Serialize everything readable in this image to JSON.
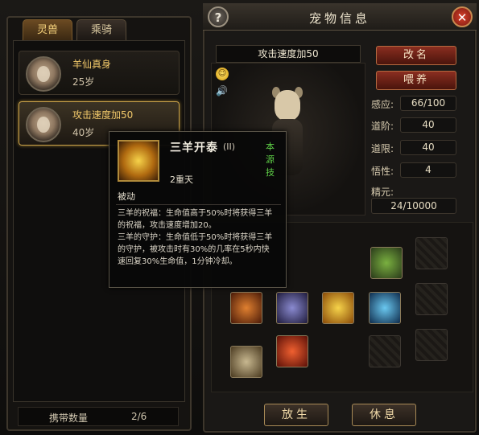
{
  "tabs": [
    "灵兽",
    "乘骑"
  ],
  "pets": [
    {
      "name": "羊仙真身",
      "age": "25岁",
      "selected": false
    },
    {
      "name": "攻击速度加50",
      "age": "40岁",
      "selected": true
    }
  ],
  "carry": {
    "label": "携带数量",
    "value": "2/6"
  },
  "header": {
    "title": "宠物信息",
    "help_label": "?",
    "close_label": "✕"
  },
  "pet_view": {
    "name": "攻击速度加50"
  },
  "actions": {
    "rename": "改名",
    "feed": "喂养",
    "release": "放生",
    "rest": "休息"
  },
  "stats": [
    {
      "label": "感应:",
      "value": "66/100"
    },
    {
      "label": "道阶:",
      "value": "40"
    },
    {
      "label": "道限:",
      "value": "40"
    },
    {
      "label": "悟性:",
      "value": "4"
    }
  ],
  "essence": {
    "label": "精元:",
    "value": "24/10000"
  },
  "tooltip": {
    "name": "三羊开泰",
    "rank": "(II)",
    "tag": "本源技",
    "level": "2重天",
    "type": "被动",
    "desc": [
      "三羊的祝福：生命值高于50%时将获得三羊",
      "的祝福，攻击速度增加20。",
      "三羊的守护：生命值低于50%时将获得三羊",
      "的守护，被攻击时有30%的几率在5秒内快",
      "速回复30%生命值，1分钟冷却。"
    ]
  },
  "icons": {
    "emote": "smile-icon",
    "speaker": "speaker-icon"
  }
}
